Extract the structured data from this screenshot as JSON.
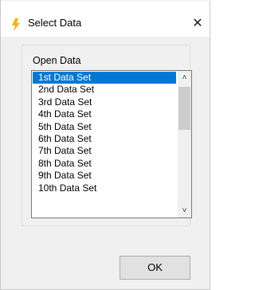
{
  "window": {
    "title": "Select Data",
    "close_glyph": "✕",
    "app_icon": "lightning-bolt-icon"
  },
  "group": {
    "label": "Open Data"
  },
  "list": {
    "selected_index": 0,
    "items": [
      "1st Data Set",
      "2nd Data Set",
      "3rd Data Set",
      "4th Data Set",
      "5th Data Set",
      "6th Data Set",
      "7th Data Set",
      "8th Data Set",
      "9th Data Set",
      "10th Data Set"
    ],
    "scroll_up_glyph": "˄",
    "scroll_down_glyph": "˅"
  },
  "buttons": {
    "ok_label": "OK"
  },
  "colors": {
    "selection": "#0078d7",
    "icon": "#f5b400"
  }
}
